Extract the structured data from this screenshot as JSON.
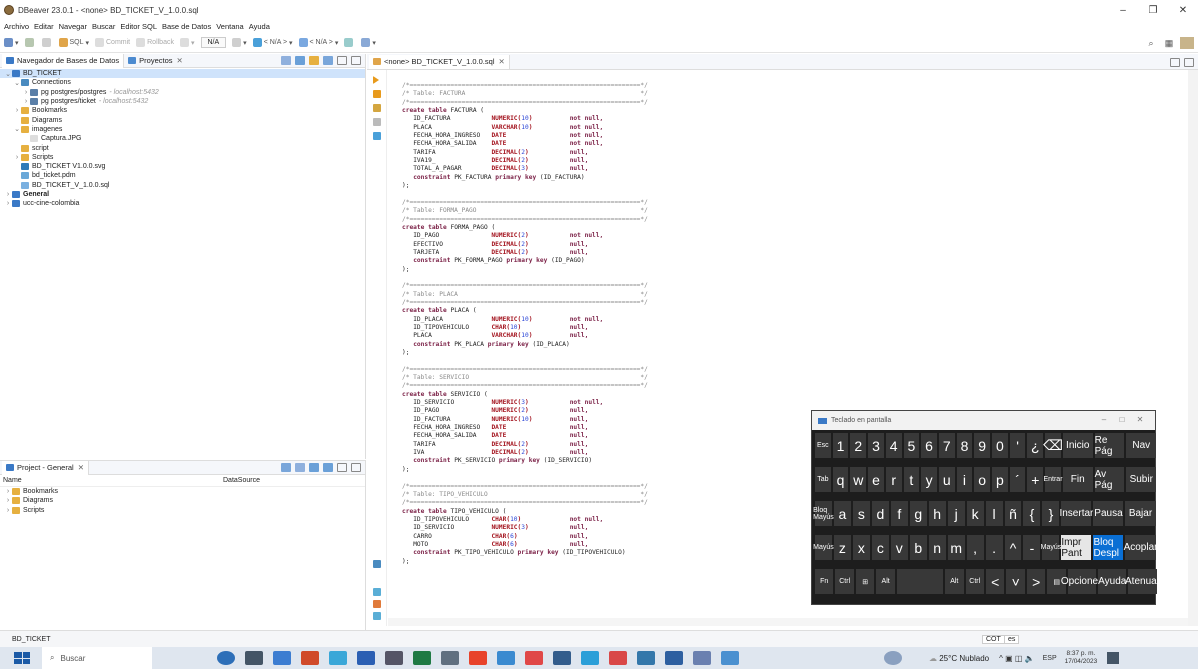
{
  "window": {
    "title": "DBeaver 23.0.1 - <none> BD_TICKET_V_1.0.0.sql"
  },
  "menu": [
    "Archivo",
    "Editar",
    "Navegar",
    "Buscar",
    "Editor SQL",
    "Base de Datos",
    "Ventana",
    "Ayuda"
  ],
  "toolbar": {
    "sql_label": "SQL",
    "commit_label": "Commit",
    "rollback_label": "Rollback",
    "na_label": "N/A",
    "ds_select": "< N/A >",
    "schema_select": "< N/A >"
  },
  "left_pane": {
    "tabs": [
      "Navegador de Bases de Datos",
      "Proyectos"
    ],
    "tree": [
      {
        "label": "BD_TICKET",
        "muted": "",
        "level": 0,
        "arrow": "v",
        "selected": true,
        "bold": false
      },
      {
        "label": "Connections",
        "muted": "",
        "level": 1,
        "arrow": "v",
        "selected": false,
        "bold": false
      },
      {
        "label": "pg postgres/postgres",
        "muted": "- localhost:5432",
        "level": 2,
        "arrow": ">",
        "selected": false,
        "bold": false
      },
      {
        "label": "pg postgres/ticket",
        "muted": "- localhost:5432",
        "level": 2,
        "arrow": ">",
        "selected": false,
        "bold": false
      },
      {
        "label": "Bookmarks",
        "muted": "",
        "level": 1,
        "arrow": ">",
        "selected": false,
        "bold": false
      },
      {
        "label": "Diagrams",
        "muted": "",
        "level": 1,
        "arrow": "",
        "selected": false,
        "bold": false
      },
      {
        "label": "imagenes",
        "muted": "",
        "level": 1,
        "arrow": "v",
        "selected": false,
        "bold": false
      },
      {
        "label": "Captura.JPG",
        "muted": "",
        "level": 2,
        "arrow": "",
        "selected": false,
        "bold": false
      },
      {
        "label": "script",
        "muted": "",
        "level": 1,
        "arrow": "",
        "selected": false,
        "bold": false
      },
      {
        "label": "Scripts",
        "muted": "",
        "level": 1,
        "arrow": ">",
        "selected": false,
        "bold": false
      },
      {
        "label": "BD_TICKET V1.0.0.svg",
        "muted": "",
        "level": 1,
        "arrow": "",
        "selected": false,
        "bold": false
      },
      {
        "label": "bd_ticket.pdm",
        "muted": "",
        "level": 1,
        "arrow": "",
        "selected": false,
        "bold": false
      },
      {
        "label": "BD_TICKET_V_1.0.0.sql",
        "muted": "",
        "level": 1,
        "arrow": "",
        "selected": false,
        "bold": false
      },
      {
        "label": "General",
        "muted": "",
        "level": 0,
        "arrow": ">",
        "selected": false,
        "bold": true
      },
      {
        "label": "ucc-cine-colombia",
        "muted": "",
        "level": 0,
        "arrow": ">",
        "selected": false,
        "bold": false
      }
    ]
  },
  "project_pane": {
    "tab": "Project - General",
    "columns": [
      "Name",
      "DataSource"
    ],
    "items": [
      "Bookmarks",
      "Diagrams",
      "Scripts"
    ]
  },
  "editor": {
    "tab": "<none> BD_TICKET_V_1.0.0.sql",
    "code_lines": [
      "/*==============================================================*/",
      "/* Table: FACTURA                                               */",
      "/*==============================================================*/",
      "create table FACTURA (",
      "   ID_FACTURA           NUMERIC(10)          not null,",
      "   PLACA                VARCHAR(10)          not null,",
      "   FECHA_HORA_INGRESO   DATE                 not null,",
      "   FECHA_HORA_SALIDA    DATE                 not null,",
      "   TARIFA               DECIMAL(2)           null,",
      "   IVA19_               DECIMAL(2)           null,",
      "   TOTAL_A_PAGAR        DECIMAL(3)           null,",
      "   constraint PK_FACTURA primary key (ID_FACTURA)",
      ");",
      "",
      "/*==============================================================*/",
      "/* Table: FORMA_PAGO                                            */",
      "/*==============================================================*/",
      "create table FORMA_PAGO (",
      "   ID_PAGO              NUMERIC(2)           not null,",
      "   EFECTIVO             DECIMAL(2)           null,",
      "   TARJETA              DECIMAL(2)           null,",
      "   constraint PK_FORMA_PAGO primary key (ID_PAGO)",
      ");",
      "",
      "/*==============================================================*/",
      "/* Table: PLACA                                                 */",
      "/*==============================================================*/",
      "create table PLACA (",
      "   ID_PLACA             NUMERIC(10)          not null,",
      "   ID_TIPOVEHICULO      CHAR(10)             null,",
      "   PLACA                VARCHAR(10)          null,",
      "   constraint PK_PLACA primary key (ID_PLACA)",
      ");",
      "",
      "/*==============================================================*/",
      "/* Table: SERVICIO                                              */",
      "/*==============================================================*/",
      "create table SERVICIO (",
      "   ID_SERVICIO          NUMERIC(3)           not null,",
      "   ID_PAGO              NUMERIC(2)           null,",
      "   ID_FACTURA           NUMERIC(10)          null,",
      "   FECHA_HORA_INGRESO   DATE                 null,",
      "   FECHA_HORA_SALIDA    DATE                 null,",
      "   TARIFA               DECIMAL(2)           null,",
      "   IVA                  DECIMAL(2)           null,",
      "   constraint PK_SERVICIO primary key (ID_SERVICIO)",
      ");",
      "",
      "/*==============================================================*/",
      "/* Table: TIPO_VEHICULO                                         */",
      "/*==============================================================*/",
      "create table TIPO_VEHICULO (",
      "   ID_TIPOVEHICULO      CHAR(10)             not null,",
      "   ID_SERVICIO          NUMERIC(3)           null,",
      "   CARRO                CHAR(6)              null,",
      "   MOTO                 CHAR(6)              null,",
      "   constraint PK_TIPO_VEHICULO primary key (ID_TIPOVEHICULO)",
      ");"
    ]
  },
  "status_bar": {
    "left": "BD_TICKET",
    "tz": "COT",
    "lang": "es"
  },
  "osk": {
    "title": "Teclado en pantalla",
    "rows": [
      [
        {
          "k": "Esc",
          "s": true
        },
        {
          "k": "1"
        },
        {
          "k": "2"
        },
        {
          "k": "3"
        },
        {
          "k": "4"
        },
        {
          "k": "5"
        },
        {
          "k": "6"
        },
        {
          "k": "7"
        },
        {
          "k": "8"
        },
        {
          "k": "9"
        },
        {
          "k": "0"
        },
        {
          "k": "'"
        },
        {
          "k": "¿"
        },
        {
          "k": "⌫"
        },
        {
          "k": "Inicio"
        },
        {
          "k": "Re Pág"
        },
        {
          "k": "Nav"
        }
      ],
      [
        {
          "k": "Tab",
          "s": true
        },
        {
          "k": "q"
        },
        {
          "k": "w"
        },
        {
          "k": "e"
        },
        {
          "k": "r"
        },
        {
          "k": "t"
        },
        {
          "k": "y"
        },
        {
          "k": "u"
        },
        {
          "k": "i"
        },
        {
          "k": "o"
        },
        {
          "k": "p"
        },
        {
          "k": "´"
        },
        {
          "k": "+"
        },
        {
          "k": "Entrar",
          "s": true
        },
        {
          "k": "Fin"
        },
        {
          "k": "Av Pág"
        },
        {
          "k": "Subir"
        }
      ],
      [
        {
          "k": "Bloq Mayús",
          "s": true
        },
        {
          "k": "a"
        },
        {
          "k": "s"
        },
        {
          "k": "d"
        },
        {
          "k": "f"
        },
        {
          "k": "g"
        },
        {
          "k": "h"
        },
        {
          "k": "j"
        },
        {
          "k": "k"
        },
        {
          "k": "l"
        },
        {
          "k": "ñ"
        },
        {
          "k": "{"
        },
        {
          "k": "}"
        },
        {
          "k": "Insertar"
        },
        {
          "k": "Pausa"
        },
        {
          "k": "Bajar"
        }
      ],
      [
        {
          "k": "Mayús",
          "s": true
        },
        {
          "k": "z"
        },
        {
          "k": "x"
        },
        {
          "k": "c"
        },
        {
          "k": "v"
        },
        {
          "k": "b"
        },
        {
          "k": "n"
        },
        {
          "k": "m"
        },
        {
          "k": ","
        },
        {
          "k": "."
        },
        {
          "k": "^"
        },
        {
          "k": "-"
        },
        {
          "k": "Mayús",
          "s": true
        },
        {
          "k": "Impr Pant",
          "s": true,
          "light": true
        },
        {
          "k": "Bloq Despl",
          "s": true,
          "blue": true
        },
        {
          "k": "Acoplar",
          "s": true
        }
      ],
      [
        {
          "k": "Fn",
          "s": true
        },
        {
          "k": "Ctrl",
          "s": true
        },
        {
          "k": "⊞",
          "s": true
        },
        {
          "k": "Alt",
          "s": true
        },
        {
          "k": " ",
          "space": true
        },
        {
          "k": "Alt",
          "s": true
        },
        {
          "k": "Ctrl",
          "s": true
        },
        {
          "k": "<"
        },
        {
          "k": "˅"
        },
        {
          "k": ">"
        },
        {
          "k": "▤",
          "s": true
        },
        {
          "k": "Opciones",
          "s": true
        },
        {
          "k": "Ayuda"
        },
        {
          "k": "Atenuar",
          "s": true
        }
      ]
    ]
  },
  "taskbar": {
    "search_placeholder": "Buscar",
    "weather": "25°C Nublado",
    "lang": "ESP",
    "time": "8:37 p. m.",
    "date": "17/04/2023"
  }
}
